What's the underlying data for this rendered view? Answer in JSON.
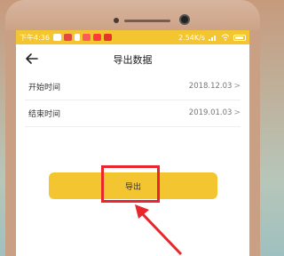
{
  "status_bar": {
    "time": "下午4:36",
    "network_speed": "2.54K/s"
  },
  "header": {
    "title": "导出数据",
    "back_icon": "arrow-left-icon"
  },
  "fields": [
    {
      "label": "开始时间",
      "value": "2018.12.03"
    },
    {
      "label": "结束时间",
      "value": "2019.01.03"
    }
  ],
  "export_button": {
    "label": "导出"
  },
  "colors": {
    "accent": "#f3c531",
    "annotation": "#e8262b"
  }
}
